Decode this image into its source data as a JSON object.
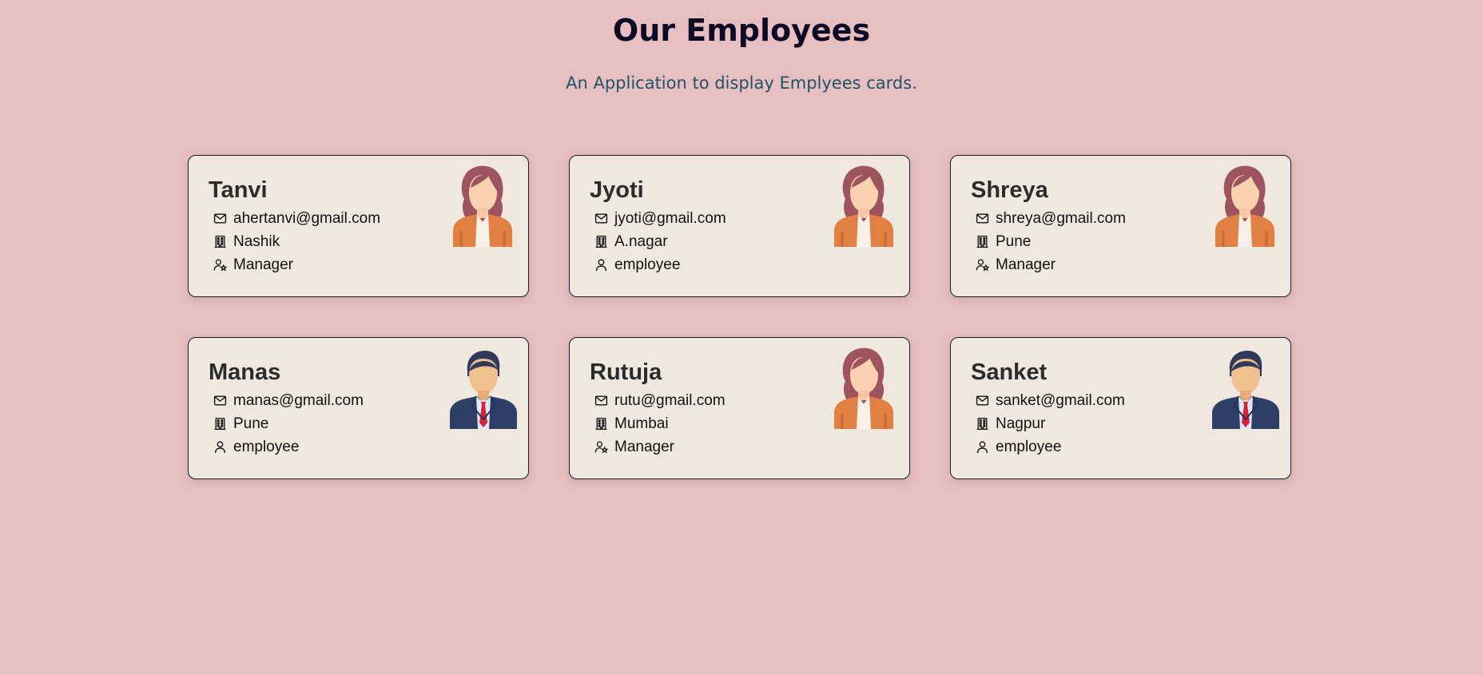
{
  "header": {
    "title": "Our Employees",
    "subtitle": "An Application to display Emplyees cards."
  },
  "colors": {
    "background": "#e7bfc0",
    "card": "#f0e8df",
    "title": "#0d0a26",
    "subtitle": "#1f5366"
  },
  "employees": [
    {
      "name": "Tanvi",
      "email": "ahertanvi@gmail.com",
      "city": "Nashik",
      "role": "Manager",
      "avatar": "female-avatar-icon",
      "role_icon": "user-star-icon"
    },
    {
      "name": "Jyoti",
      "email": "jyoti@gmail.com",
      "city": "A.nagar",
      "role": "employee",
      "avatar": "female-avatar-icon",
      "role_icon": "user-icon"
    },
    {
      "name": "Shreya",
      "email": "shreya@gmail.com",
      "city": "Pune",
      "role": "Manager",
      "avatar": "female-avatar-icon",
      "role_icon": "user-star-icon"
    },
    {
      "name": "Manas",
      "email": "manas@gmail.com",
      "city": "Pune",
      "role": "employee",
      "avatar": "male-avatar-icon",
      "role_icon": "user-icon"
    },
    {
      "name": "Rutuja",
      "email": "rutu@gmail.com",
      "city": "Mumbai",
      "role": "Manager",
      "avatar": "female-avatar-icon",
      "role_icon": "user-star-icon"
    },
    {
      "name": "Sanket",
      "email": "sanket@gmail.com",
      "city": "Nagpur",
      "role": "employee",
      "avatar": "male-avatar-icon",
      "role_icon": "user-icon"
    }
  ]
}
